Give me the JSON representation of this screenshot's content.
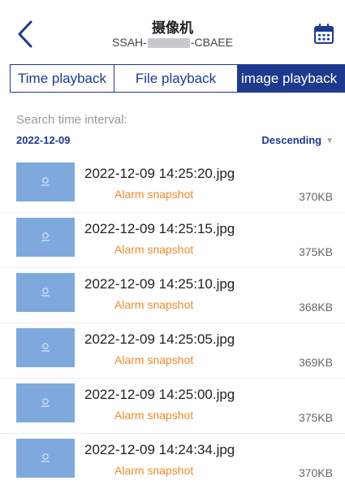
{
  "header": {
    "title": "摄像机",
    "device_prefix": "SSAH-",
    "device_suffix": "-CBAEE",
    "back_icon": "chevron-left-icon",
    "calendar_icon": "calendar-icon"
  },
  "tabs": [
    {
      "label": "Time playback",
      "active": false
    },
    {
      "label": "File playback",
      "active": false
    },
    {
      "label": "image playback",
      "active": true
    }
  ],
  "search": {
    "label": "Search time interval:",
    "date": "2022-12-09",
    "sort_label": "Descending"
  },
  "colors": {
    "accent": "#1d3a8e",
    "tag": "#f08a2c",
    "thumbnail": "#7fa9dc"
  },
  "files": [
    {
      "name": "2022-12-09 14:25:20.jpg",
      "tag": "Alarm snapshot",
      "size": "370KB"
    },
    {
      "name": "2022-12-09 14:25:15.jpg",
      "tag": "Alarm snapshot",
      "size": "375KB"
    },
    {
      "name": "2022-12-09 14:25:10.jpg",
      "tag": "Alarm snapshot",
      "size": "368KB"
    },
    {
      "name": "2022-12-09 14:25:05.jpg",
      "tag": "Alarm snapshot",
      "size": "369KB"
    },
    {
      "name": "2022-12-09 14:25:00.jpg",
      "tag": "Alarm snapshot",
      "size": "375KB"
    },
    {
      "name": "2022-12-09 14:24:34.jpg",
      "tag": "Alarm snapshot",
      "size": "370KB"
    }
  ]
}
